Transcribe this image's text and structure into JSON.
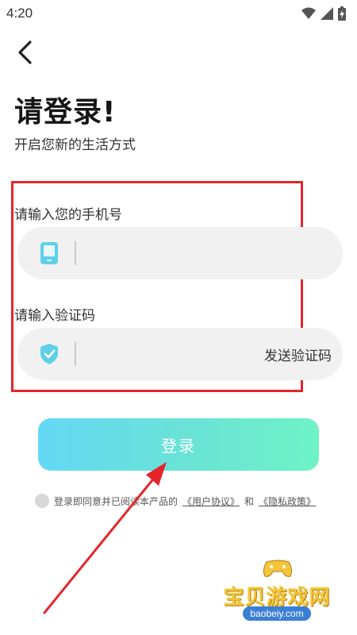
{
  "status_bar": {
    "time": "4:20"
  },
  "header": {
    "title": "请登录!",
    "subtitle": "开启您新的生活方式"
  },
  "form": {
    "phone_label": "请输入您的手机号",
    "phone_value": "",
    "code_label": "请输入验证码",
    "code_value": "",
    "send_code_label": "发送验证码"
  },
  "login_button": {
    "label": "登录"
  },
  "agreement": {
    "prefix": "登录即同意并已阅读本产品的",
    "user_agreement": "《用户协议》",
    "conjunction": "和",
    "privacy_policy": "《隐私政策》",
    "checked": false
  },
  "watermark": {
    "name": "宝贝游戏网",
    "domain": "baobeiy.com"
  },
  "colors": {
    "annotation": "#e4262b",
    "login_gradient_start": "#64d8f5",
    "login_gradient_end": "#6ef3c6",
    "input_background": "#f1f1f1",
    "icon_accent": "#5ed0e8"
  },
  "icons": {
    "back": "back-arrow-icon",
    "phone": "phone-icon",
    "shield": "shield-check-icon",
    "wifi": "wifi-icon",
    "signal": "signal-icon",
    "battery": "battery-icon"
  }
}
